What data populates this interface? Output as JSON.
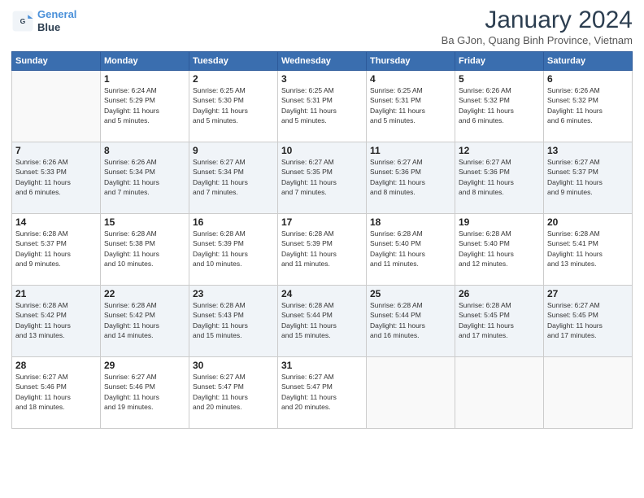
{
  "logo": {
    "line1": "General",
    "line2": "Blue"
  },
  "title": "January 2024",
  "location": "Ba GJon, Quang Binh Province, Vietnam",
  "days_of_week": [
    "Sunday",
    "Monday",
    "Tuesday",
    "Wednesday",
    "Thursday",
    "Friday",
    "Saturday"
  ],
  "weeks": [
    [
      {
        "num": "",
        "info": ""
      },
      {
        "num": "1",
        "info": "Sunrise: 6:24 AM\nSunset: 5:29 PM\nDaylight: 11 hours\nand 5 minutes."
      },
      {
        "num": "2",
        "info": "Sunrise: 6:25 AM\nSunset: 5:30 PM\nDaylight: 11 hours\nand 5 minutes."
      },
      {
        "num": "3",
        "info": "Sunrise: 6:25 AM\nSunset: 5:31 PM\nDaylight: 11 hours\nand 5 minutes."
      },
      {
        "num": "4",
        "info": "Sunrise: 6:25 AM\nSunset: 5:31 PM\nDaylight: 11 hours\nand 5 minutes."
      },
      {
        "num": "5",
        "info": "Sunrise: 6:26 AM\nSunset: 5:32 PM\nDaylight: 11 hours\nand 6 minutes."
      },
      {
        "num": "6",
        "info": "Sunrise: 6:26 AM\nSunset: 5:32 PM\nDaylight: 11 hours\nand 6 minutes."
      }
    ],
    [
      {
        "num": "7",
        "info": "Sunrise: 6:26 AM\nSunset: 5:33 PM\nDaylight: 11 hours\nand 6 minutes."
      },
      {
        "num": "8",
        "info": "Sunrise: 6:26 AM\nSunset: 5:34 PM\nDaylight: 11 hours\nand 7 minutes."
      },
      {
        "num": "9",
        "info": "Sunrise: 6:27 AM\nSunset: 5:34 PM\nDaylight: 11 hours\nand 7 minutes."
      },
      {
        "num": "10",
        "info": "Sunrise: 6:27 AM\nSunset: 5:35 PM\nDaylight: 11 hours\nand 7 minutes."
      },
      {
        "num": "11",
        "info": "Sunrise: 6:27 AM\nSunset: 5:36 PM\nDaylight: 11 hours\nand 8 minutes."
      },
      {
        "num": "12",
        "info": "Sunrise: 6:27 AM\nSunset: 5:36 PM\nDaylight: 11 hours\nand 8 minutes."
      },
      {
        "num": "13",
        "info": "Sunrise: 6:27 AM\nSunset: 5:37 PM\nDaylight: 11 hours\nand 9 minutes."
      }
    ],
    [
      {
        "num": "14",
        "info": "Sunrise: 6:28 AM\nSunset: 5:37 PM\nDaylight: 11 hours\nand 9 minutes."
      },
      {
        "num": "15",
        "info": "Sunrise: 6:28 AM\nSunset: 5:38 PM\nDaylight: 11 hours\nand 10 minutes."
      },
      {
        "num": "16",
        "info": "Sunrise: 6:28 AM\nSunset: 5:39 PM\nDaylight: 11 hours\nand 10 minutes."
      },
      {
        "num": "17",
        "info": "Sunrise: 6:28 AM\nSunset: 5:39 PM\nDaylight: 11 hours\nand 11 minutes."
      },
      {
        "num": "18",
        "info": "Sunrise: 6:28 AM\nSunset: 5:40 PM\nDaylight: 11 hours\nand 11 minutes."
      },
      {
        "num": "19",
        "info": "Sunrise: 6:28 AM\nSunset: 5:40 PM\nDaylight: 11 hours\nand 12 minutes."
      },
      {
        "num": "20",
        "info": "Sunrise: 6:28 AM\nSunset: 5:41 PM\nDaylight: 11 hours\nand 13 minutes."
      }
    ],
    [
      {
        "num": "21",
        "info": "Sunrise: 6:28 AM\nSunset: 5:42 PM\nDaylight: 11 hours\nand 13 minutes."
      },
      {
        "num": "22",
        "info": "Sunrise: 6:28 AM\nSunset: 5:42 PM\nDaylight: 11 hours\nand 14 minutes."
      },
      {
        "num": "23",
        "info": "Sunrise: 6:28 AM\nSunset: 5:43 PM\nDaylight: 11 hours\nand 15 minutes."
      },
      {
        "num": "24",
        "info": "Sunrise: 6:28 AM\nSunset: 5:44 PM\nDaylight: 11 hours\nand 15 minutes."
      },
      {
        "num": "25",
        "info": "Sunrise: 6:28 AM\nSunset: 5:44 PM\nDaylight: 11 hours\nand 16 minutes."
      },
      {
        "num": "26",
        "info": "Sunrise: 6:28 AM\nSunset: 5:45 PM\nDaylight: 11 hours\nand 17 minutes."
      },
      {
        "num": "27",
        "info": "Sunrise: 6:27 AM\nSunset: 5:45 PM\nDaylight: 11 hours\nand 17 minutes."
      }
    ],
    [
      {
        "num": "28",
        "info": "Sunrise: 6:27 AM\nSunset: 5:46 PM\nDaylight: 11 hours\nand 18 minutes."
      },
      {
        "num": "29",
        "info": "Sunrise: 6:27 AM\nSunset: 5:46 PM\nDaylight: 11 hours\nand 19 minutes."
      },
      {
        "num": "30",
        "info": "Sunrise: 6:27 AM\nSunset: 5:47 PM\nDaylight: 11 hours\nand 20 minutes."
      },
      {
        "num": "31",
        "info": "Sunrise: 6:27 AM\nSunset: 5:47 PM\nDaylight: 11 hours\nand 20 minutes."
      },
      {
        "num": "",
        "info": ""
      },
      {
        "num": "",
        "info": ""
      },
      {
        "num": "",
        "info": ""
      }
    ]
  ]
}
